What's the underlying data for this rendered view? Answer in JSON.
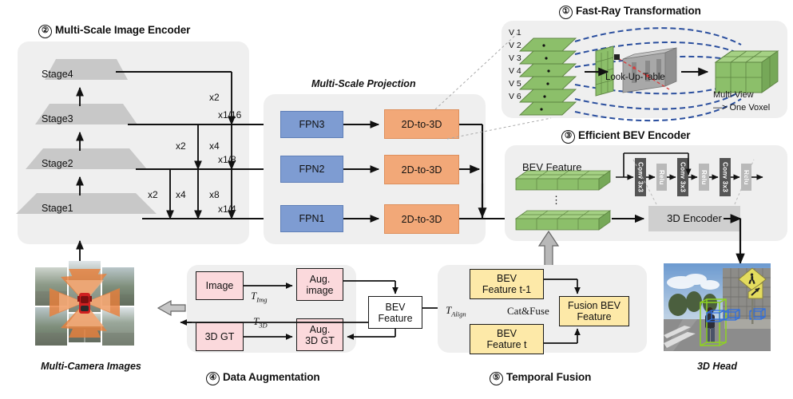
{
  "sections": {
    "fast_ray": {
      "num": "①",
      "title": "Fast-Ray Transformation"
    },
    "encoder": {
      "num": "②",
      "title": "Multi-Scale Image Encoder"
    },
    "bev": {
      "num": "③",
      "title": "Efficient BEV  Encoder"
    },
    "aug": {
      "num": "④",
      "title": "Data Augmentation"
    },
    "temporal": {
      "num": "⑤",
      "title": "Temporal Fusion"
    }
  },
  "captions": {
    "projection": "Multi-Scale Projection",
    "multi_camera": "Multi-Camera Images",
    "head": "3D Head"
  },
  "encoder": {
    "stages": [
      "Stage4",
      "Stage3",
      "Stage2",
      "Stage1"
    ],
    "scales": [
      "x1/16",
      "x1/8",
      "x1/4"
    ],
    "upsample_labels": [
      "x2",
      "x2",
      "x4",
      "x2",
      "x4",
      "x8"
    ]
  },
  "projection": {
    "fpn": [
      "FPN3",
      "FPN2",
      "FPN1"
    ],
    "proj": [
      "2D-to-3D",
      "2D-to-3D",
      "2D-to-3D"
    ]
  },
  "fast_ray": {
    "views": [
      "V 1",
      "V 2",
      "V 3",
      "V 4",
      "V 5",
      "V 6"
    ],
    "lut_label": "Look-Up-Table",
    "voxel_line1": "Multi-View",
    "voxel_line2": "—>  One Voxel"
  },
  "bev_encoder": {
    "feature_label": "BEV Feature",
    "ellipsis": "⋮",
    "blocks": [
      "Conv 3x3",
      "Relu",
      "Conv 3x3",
      "Relu",
      "Conv 3x3",
      "Relu"
    ],
    "encoder_label": "3D Encoder"
  },
  "augmentation": {
    "image": "Image",
    "aug_image_l1": "Aug.",
    "aug_image_l2": "image",
    "gt": "3D GT",
    "aug_gt_l1": "Aug.",
    "aug_gt_l2": "3D GT",
    "t_img": "T",
    "t_img_sub": "Img",
    "t_3d": "T",
    "t_3d_sub": "3D",
    "bev_l1": "BEV",
    "bev_l2": "Feature"
  },
  "temporal": {
    "t_align": "T",
    "t_align_sub": "Align",
    "prev_l1": "BEV",
    "prev_l2": "Feature t-1",
    "cur_l1": "BEV",
    "cur_l2": "Feature t",
    "catfuse": "Cat&Fuse",
    "fusion_l1": "Fusion BEV",
    "fusion_l2": "Feature"
  },
  "colors": {
    "fpn": "#7e9cd2",
    "proj": "#f2a878",
    "voxel_green": "#8cbf6a",
    "panel": "#efefef",
    "pink": "#fbd9dc",
    "yellow": "#fde9a8",
    "dashed_blue": "#2b4f9e"
  }
}
